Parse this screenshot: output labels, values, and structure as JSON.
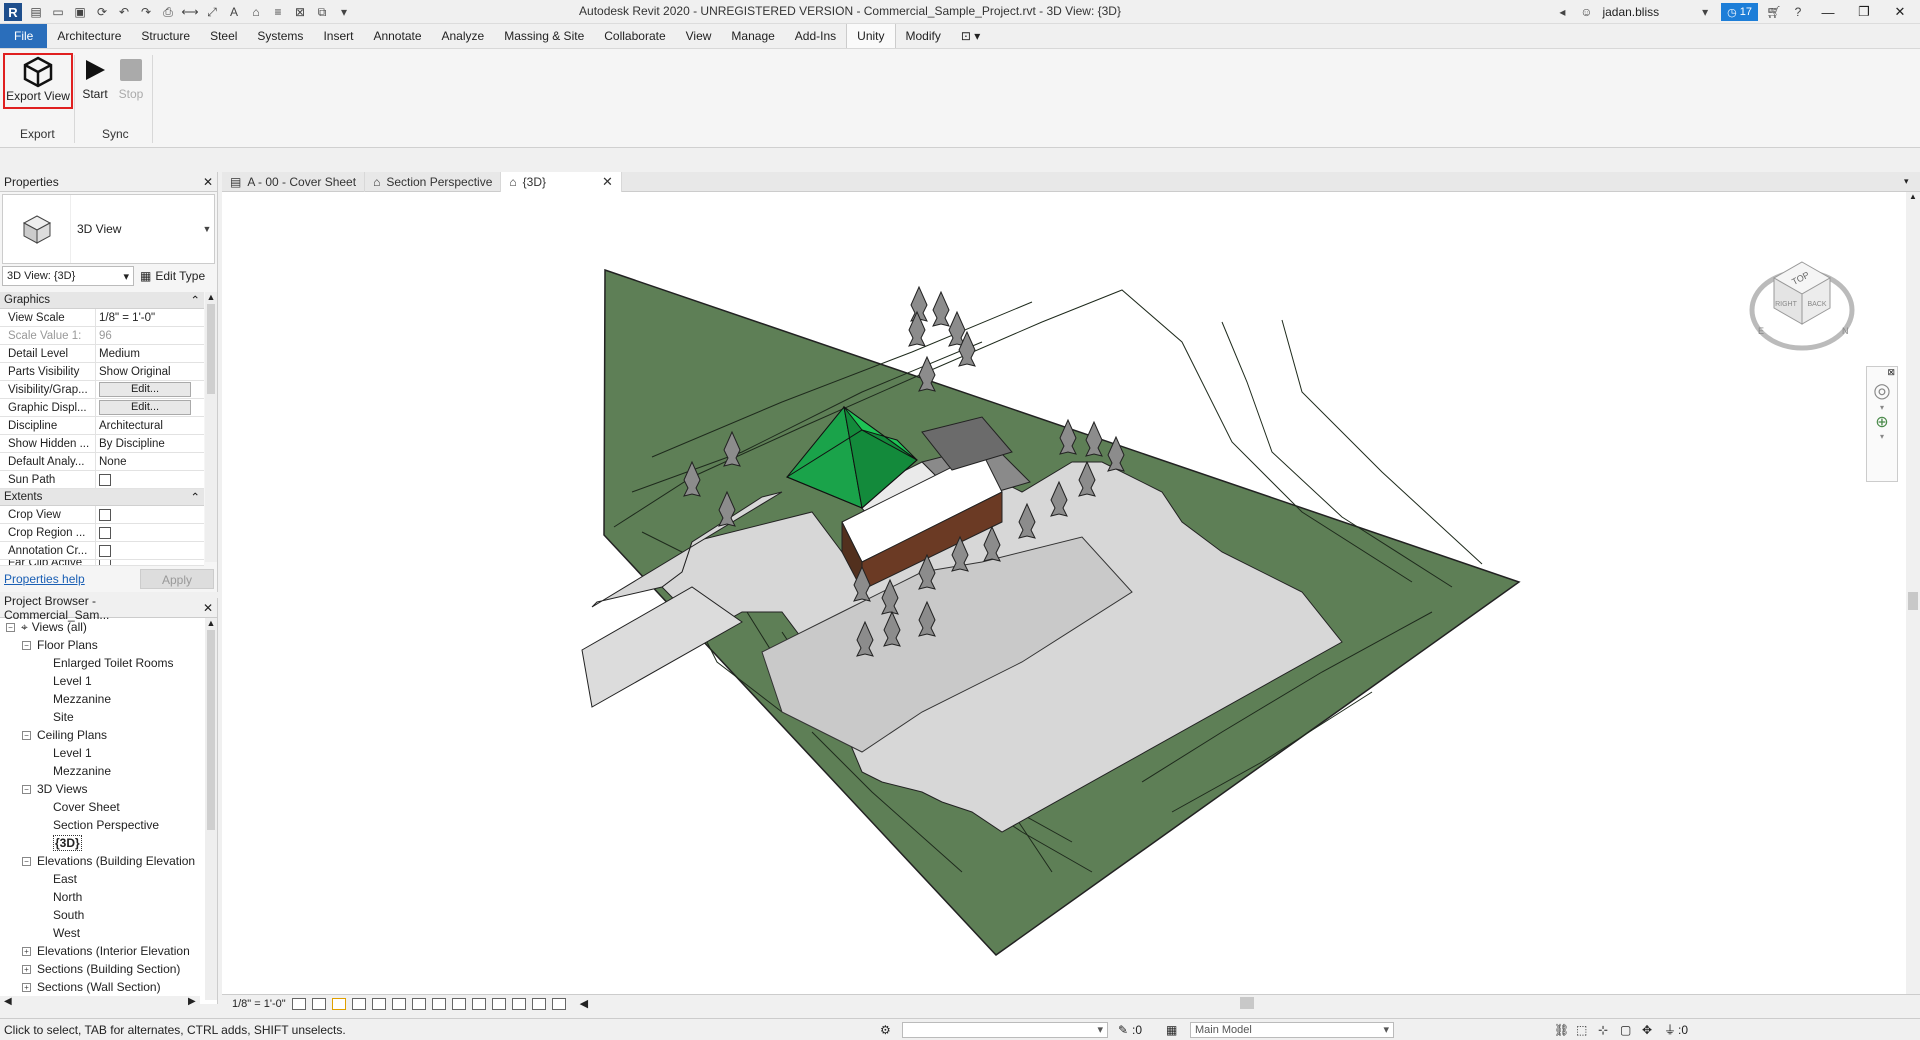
{
  "app": {
    "title": "Autodesk Revit 2020 - UNREGISTERED VERSION - Commercial_Sample_Project.rvt - 3D View: {3D}",
    "logo": "R",
    "user": "jadan.bliss",
    "notification_count": "17"
  },
  "menu_tabs": [
    {
      "label": "File"
    },
    {
      "label": "Architecture"
    },
    {
      "label": "Structure"
    },
    {
      "label": "Steel"
    },
    {
      "label": "Systems"
    },
    {
      "label": "Insert"
    },
    {
      "label": "Annotate"
    },
    {
      "label": "Analyze"
    },
    {
      "label": "Massing & Site"
    },
    {
      "label": "Collaborate"
    },
    {
      "label": "View"
    },
    {
      "label": "Manage"
    },
    {
      "label": "Add-Ins"
    },
    {
      "label": "Unity"
    },
    {
      "label": "Modify"
    }
  ],
  "ribbon": {
    "export_view": "Export View",
    "start": "Start",
    "stop": "Stop",
    "panel_export": "Export",
    "panel_sync": "Sync"
  },
  "properties": {
    "header": "Properties",
    "type_name": "3D View",
    "instance": "3D View: {3D}",
    "edit_type": "Edit Type",
    "sections": {
      "graphics": "Graphics",
      "extents": "Extents"
    },
    "graphics_rows": [
      {
        "k": "View Scale",
        "v": "1/8\" = 1'-0\""
      },
      {
        "k": "Scale Value    1:",
        "v": "96"
      },
      {
        "k": "Detail Level",
        "v": "Medium"
      },
      {
        "k": "Parts Visibility",
        "v": "Show Original"
      },
      {
        "k": "Visibility/Grap...",
        "v": "Edit..."
      },
      {
        "k": "Graphic Displ...",
        "v": "Edit..."
      },
      {
        "k": "Discipline",
        "v": "Architectural"
      },
      {
        "k": "Show Hidden ...",
        "v": "By Discipline"
      },
      {
        "k": "Default Analy...",
        "v": "None"
      },
      {
        "k": "Sun Path",
        "v": ""
      }
    ],
    "extents_rows": [
      {
        "k": "Crop View"
      },
      {
        "k": "Crop Region ..."
      },
      {
        "k": "Annotation Cr..."
      },
      {
        "k": "Far Clip Active"
      }
    ],
    "help": "Properties help",
    "apply": "Apply"
  },
  "browser": {
    "header": "Project Browser - Commercial_Sam...",
    "nodes": [
      {
        "label": "Views (all)",
        "level": 0,
        "exp": "−"
      },
      {
        "label": "Floor Plans",
        "level": 1,
        "exp": "−"
      },
      {
        "label": "Enlarged Toilet Rooms",
        "level": 2
      },
      {
        "label": "Level 1",
        "level": 2
      },
      {
        "label": "Mezzanine",
        "level": 2
      },
      {
        "label": "Site",
        "level": 2
      },
      {
        "label": "Ceiling Plans",
        "level": 1,
        "exp": "−"
      },
      {
        "label": "Level 1",
        "level": 2
      },
      {
        "label": "Mezzanine",
        "level": 2
      },
      {
        "label": "3D Views",
        "level": 1,
        "exp": "−"
      },
      {
        "label": "Cover Sheet",
        "level": 2
      },
      {
        "label": "Section Perspective",
        "level": 2
      },
      {
        "label": "{3D}",
        "level": 2,
        "sel": true
      },
      {
        "label": "Elevations (Building Elevation",
        "level": 1,
        "exp": "−"
      },
      {
        "label": "East",
        "level": 2
      },
      {
        "label": "North",
        "level": 2
      },
      {
        "label": "South",
        "level": 2
      },
      {
        "label": "West",
        "level": 2
      },
      {
        "label": "Elevations (Interior Elevation",
        "level": 1,
        "exp": "+"
      },
      {
        "label": "Sections (Building Section)",
        "level": 1,
        "exp": "+"
      },
      {
        "label": "Sections (Wall Section)",
        "level": 1,
        "exp": "+"
      }
    ]
  },
  "view_tabs": [
    {
      "label": "A - 00 - Cover Sheet"
    },
    {
      "label": "Section Perspective"
    },
    {
      "label": "{3D}"
    }
  ],
  "viewcube": {
    "top": "TOP",
    "right": "RIGHT",
    "back": "BACK",
    "e": "E",
    "n": "N"
  },
  "viewbar": {
    "scale": "1/8\" = 1'-0\""
  },
  "status": {
    "message": "Click to select, TAB for alternates, CTRL adds, SHIFT unselects.",
    "count_a": ":0",
    "model": "Main Model",
    "count_b": ":0"
  },
  "colors": {
    "accent": "#2a6ebb",
    "terrain": "#5e7f56",
    "roof": "#1aa34a",
    "highlight": "#e02020"
  }
}
